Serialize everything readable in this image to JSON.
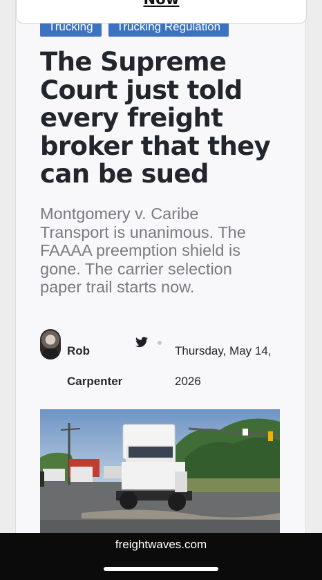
{
  "top_banner": {
    "link_text": "Now"
  },
  "tags": [
    "Trucking",
    "Trucking Regulation"
  ],
  "article": {
    "headline": "The Supreme Court just told every freight broker that they can be sued",
    "dek": "Montgomery v. Caribe Transport is unanimous. The FAAAA preemption shield is gone. The carrier selection paper trail starts now.",
    "author": "Rob Carpenter",
    "date": "Thursday, May 14, 2026"
  },
  "icons": {
    "social": "twitter-icon",
    "separator": "dot"
  },
  "colors": {
    "tag_bg": "#3b73c2",
    "headline": "#22252b",
    "dek": "#7a7b7f",
    "bar": "#0b0b0c"
  },
  "browser": {
    "domain": "freightwaves.com"
  }
}
